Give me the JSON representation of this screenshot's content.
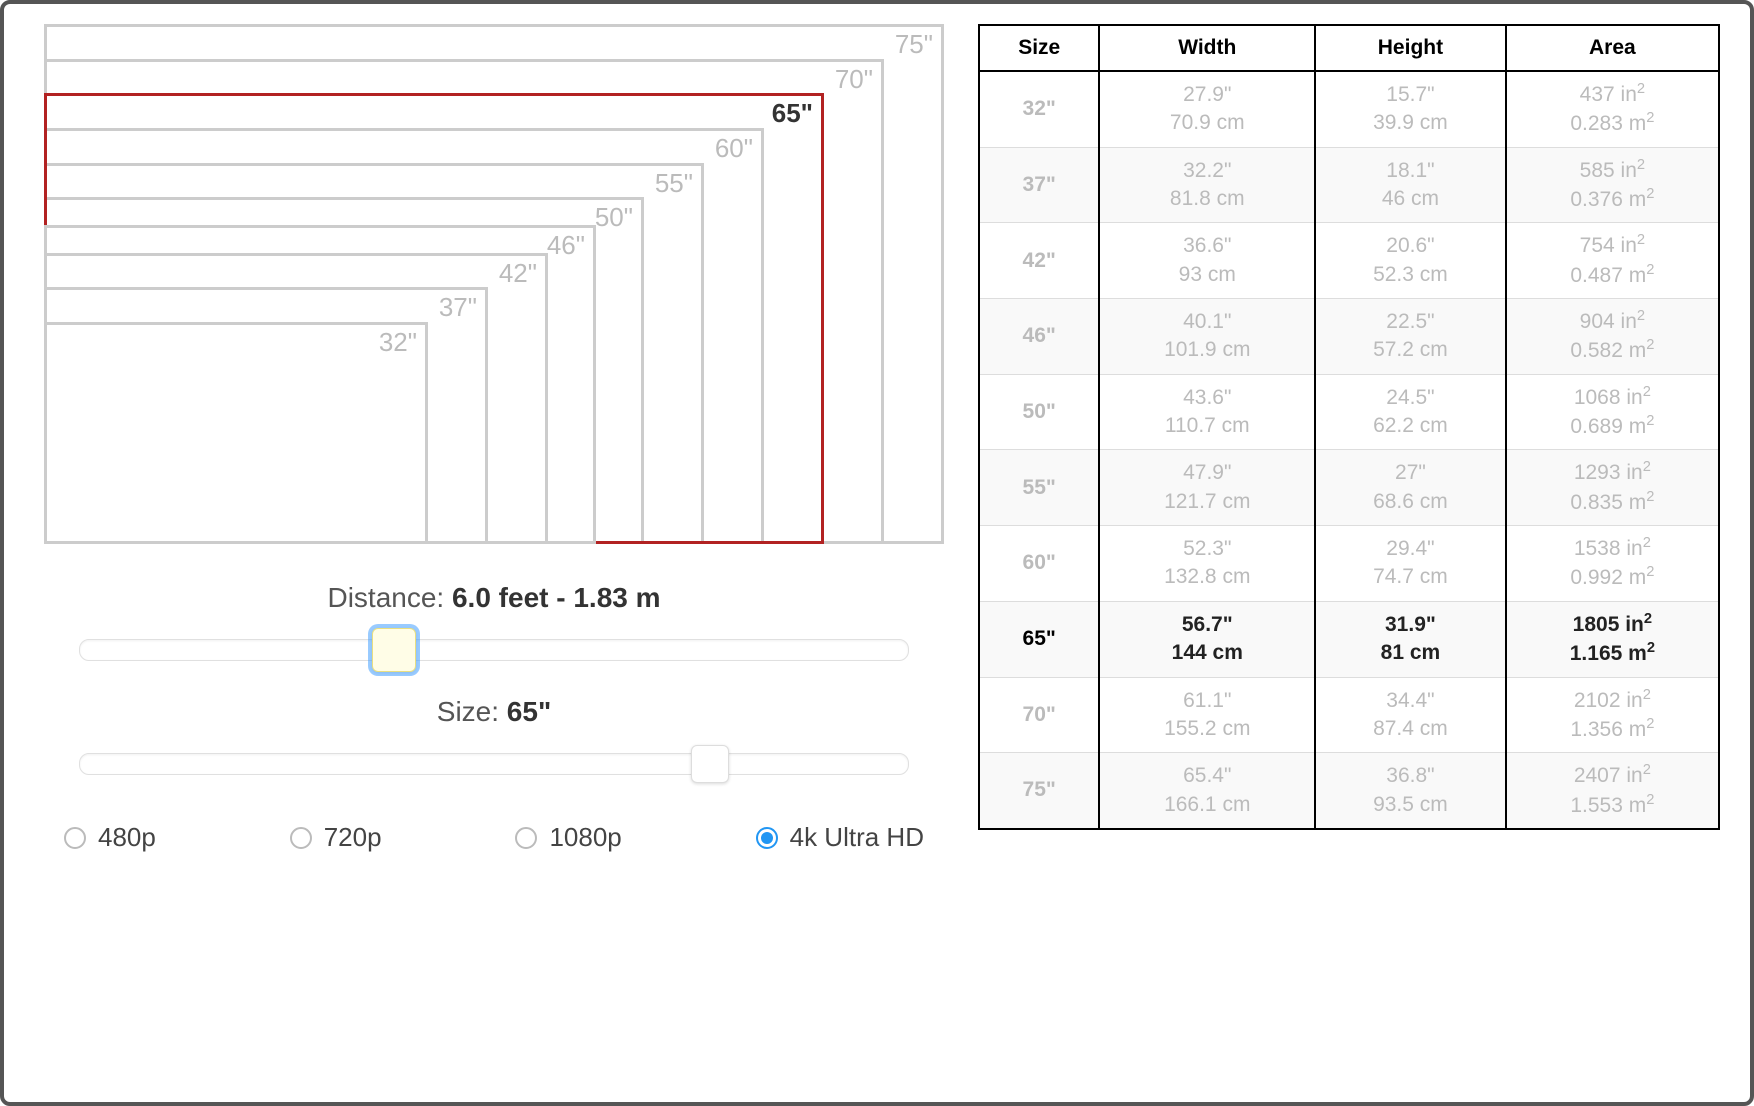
{
  "selected_size": "65\"",
  "distance": {
    "label": "Distance:",
    "value": "6.0 feet - 1.83 m",
    "slider_percent": 38
  },
  "size": {
    "label": "Size:",
    "value": "65\"",
    "slider_percent": 76
  },
  "resolutions": [
    {
      "label": "480p",
      "selected": false
    },
    {
      "label": "720p",
      "selected": false
    },
    {
      "label": "1080p",
      "selected": false
    },
    {
      "label": "4k Ultra HD",
      "selected": true
    }
  ],
  "sizes_box_labels": [
    "32\"",
    "37\"",
    "42\"",
    "46\"",
    "50\"",
    "55\"",
    "60\"",
    "65\"",
    "70\"",
    "75\""
  ],
  "table_headers": [
    "Size",
    "Width",
    "Height",
    "Area"
  ],
  "table_rows": [
    {
      "size": "32\"",
      "width_in": "27.9\"",
      "width_cm": "70.9 cm",
      "height_in": "15.7\"",
      "height_cm": "39.9 cm",
      "area_in": "437 in²",
      "area_m": "0.283 m²",
      "selected": false
    },
    {
      "size": "37\"",
      "width_in": "32.2\"",
      "width_cm": "81.8 cm",
      "height_in": "18.1\"",
      "height_cm": "46 cm",
      "area_in": "585 in²",
      "area_m": "0.376 m²",
      "selected": false
    },
    {
      "size": "42\"",
      "width_in": "36.6\"",
      "width_cm": "93 cm",
      "height_in": "20.6\"",
      "height_cm": "52.3 cm",
      "area_in": "754 in²",
      "area_m": "0.487 m²",
      "selected": false
    },
    {
      "size": "46\"",
      "width_in": "40.1\"",
      "width_cm": "101.9 cm",
      "height_in": "22.5\"",
      "height_cm": "57.2 cm",
      "area_in": "904 in²",
      "area_m": "0.582 m²",
      "selected": false
    },
    {
      "size": "50\"",
      "width_in": "43.6\"",
      "width_cm": "110.7 cm",
      "height_in": "24.5\"",
      "height_cm": "62.2 cm",
      "area_in": "1068 in²",
      "area_m": "0.689 m²",
      "selected": false
    },
    {
      "size": "55\"",
      "width_in": "47.9\"",
      "width_cm": "121.7 cm",
      "height_in": "27\"",
      "height_cm": "68.6 cm",
      "area_in": "1293 in²",
      "area_m": "0.835 m²",
      "selected": false
    },
    {
      "size": "60\"",
      "width_in": "52.3\"",
      "width_cm": "132.8 cm",
      "height_in": "29.4\"",
      "height_cm": "74.7 cm",
      "area_in": "1538 in²",
      "area_m": "0.992 m²",
      "selected": false
    },
    {
      "size": "65\"",
      "width_in": "56.7\"",
      "width_cm": "144 cm",
      "height_in": "31.9\"",
      "height_cm": "81 cm",
      "area_in": "1805 in²",
      "area_m": "1.165 m²",
      "selected": true
    },
    {
      "size": "70\"",
      "width_in": "61.1\"",
      "width_cm": "155.2 cm",
      "height_in": "34.4\"",
      "height_cm": "87.4 cm",
      "area_in": "2102 in²",
      "area_m": "1.356 m²",
      "selected": false
    },
    {
      "size": "75\"",
      "width_in": "65.4\"",
      "width_cm": "166.1 cm",
      "height_in": "36.8\"",
      "height_cm": "93.5 cm",
      "area_in": "2407 in²",
      "area_m": "1.553 m²",
      "selected": false
    }
  ]
}
